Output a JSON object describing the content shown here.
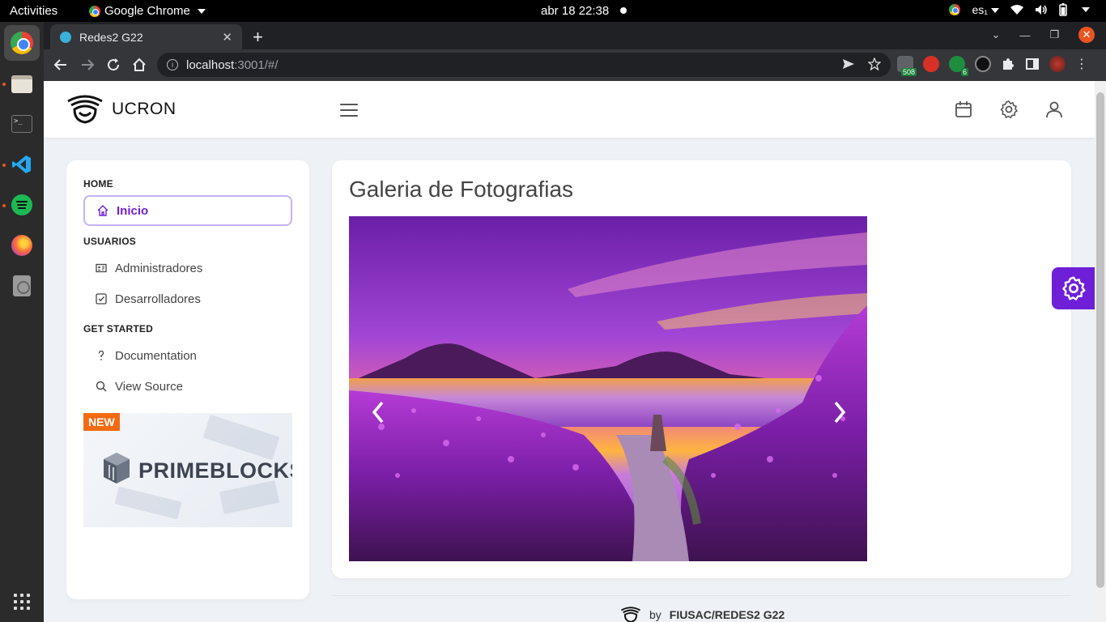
{
  "os_bar": {
    "activities": "Activities",
    "app_menu": "Google Chrome",
    "clock": "abr 18  22:38",
    "lang": "es₁"
  },
  "browser": {
    "tab_title": "Redes2 G22",
    "url_host": "localhost",
    "url_path": ":3001/#/",
    "ext_badge_1": "508",
    "ext_badge_2": "6"
  },
  "header": {
    "app_name": "UCRON"
  },
  "sidebar": {
    "sections": [
      {
        "title": "HOME"
      },
      {
        "title": "USUARIOS"
      },
      {
        "title": "GET STARTED"
      }
    ],
    "items": [
      {
        "label": "Inicio"
      },
      {
        "label": "Administradores"
      },
      {
        "label": "Desarrolladores"
      },
      {
        "label": "Documentation"
      },
      {
        "label": "View Source"
      }
    ],
    "promo": {
      "badge": "NEW",
      "brand": "PRIMEBLOCKS"
    }
  },
  "main": {
    "title": "Galeria de Fotografias"
  },
  "footer": {
    "by": "by",
    "credit": "FIUSAC/REDES2 G22"
  },
  "colors": {
    "accent": "#6f1fd8",
    "accent_border": "#c4b3f5",
    "page_bg": "#eef1f5",
    "promo_badge": "#f26b13"
  }
}
